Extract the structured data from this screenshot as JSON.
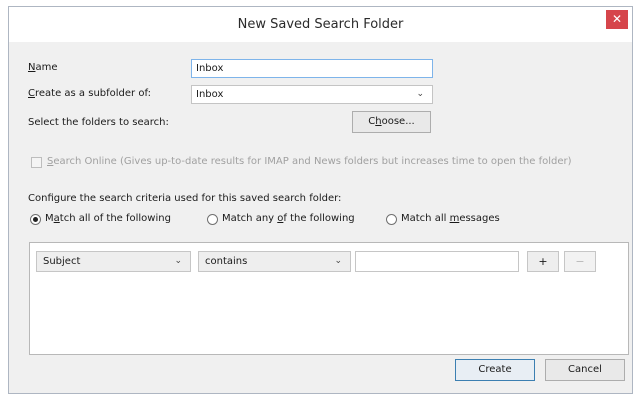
{
  "dialog": {
    "title": "New Saved Search Folder",
    "close_glyph": "✕",
    "name_label_access": "N",
    "name_label_rest": "ame",
    "name_value": "Inbox",
    "subfolder_label_access": "C",
    "subfolder_label_rest": "reate as a subfolder of:",
    "subfolder_value": "Inbox",
    "select_folders_label": "Select the folders to search:",
    "choose_button_pre": "C",
    "choose_button_access": "h",
    "choose_button_post": "oose...",
    "search_online_access": "S",
    "search_online_rest": "earch Online (Gives up-to-date results for IMAP and News folders but increases time to open the folder)",
    "criteria_heading": "Configure the search criteria used for this saved search folder:",
    "radios": {
      "all_pre": "M",
      "all_access": "a",
      "all_post": "tch all of the following",
      "any_pre": "Match any ",
      "any_access": "o",
      "any_post": "f the following",
      "msgs_pre": "Match all ",
      "msgs_access": "m",
      "msgs_post": "essages",
      "selected": "all"
    },
    "criteria_row": {
      "field": "Subject",
      "operator": "contains",
      "value": "",
      "add_label": "+",
      "remove_label": "−"
    },
    "create_button": "Create",
    "cancel_button": "Cancel",
    "chevron_glyph": "⌄"
  }
}
